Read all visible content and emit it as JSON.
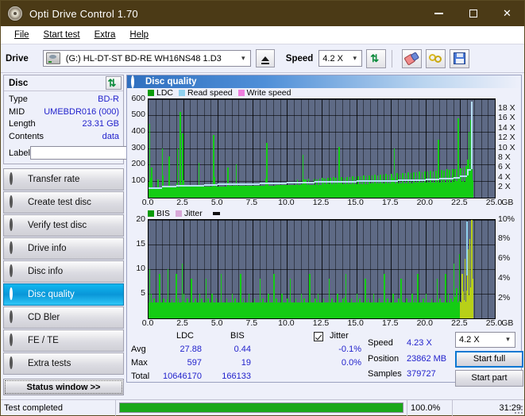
{
  "window": {
    "title": "Opti Drive Control 1.70",
    "icon": "disc-icon",
    "minimize": "–",
    "maximize": "□",
    "close": "✕"
  },
  "menubar": {
    "items": [
      "File",
      "Start test",
      "Extra",
      "Help"
    ]
  },
  "drivebar": {
    "drive_label": "Drive",
    "drive_value": "(G:)  HL-DT-ST BD-RE  WH16NS48 1.D3",
    "eject_icon": "eject-icon",
    "speed_label": "Speed",
    "speed_value": "4.2 X",
    "refresh_icon": "refresh-icon",
    "eraser_icon": "eraser-icon",
    "rings_icon": "rings-icon",
    "save_icon": "floppy-save-icon"
  },
  "disc": {
    "title": "Disc",
    "refresh_icon": "refresh-icon",
    "rows": [
      {
        "key": "Type",
        "value": "BD-R"
      },
      {
        "key": "MID",
        "value": "UMEBDR016 (000)"
      },
      {
        "key": "Length",
        "value": "23.31 GB"
      },
      {
        "key": "Contents",
        "value": "data"
      }
    ],
    "label_key": "Label",
    "label_value": "",
    "label_placeholder": "",
    "cd_icon": "cd-disc-icon"
  },
  "sidebar": {
    "items": [
      {
        "label": "Transfer rate",
        "active": false
      },
      {
        "label": "Create test disc",
        "active": false
      },
      {
        "label": "Verify test disc",
        "active": false
      },
      {
        "label": "Drive info",
        "active": false
      },
      {
        "label": "Disc info",
        "active": false
      },
      {
        "label": "Disc quality",
        "active": true
      },
      {
        "label": "CD Bler",
        "active": false
      },
      {
        "label": "FE / TE",
        "active": false
      },
      {
        "label": "Extra tests",
        "active": false
      }
    ],
    "status_window_button": "Status window >>"
  },
  "panel": {
    "title": "Disc quality",
    "icon": "disc-quality-icon"
  },
  "stats": {
    "col_ldc": "LDC",
    "col_bis": "BIS",
    "row_avg": "Avg",
    "row_max": "Max",
    "row_total": "Total",
    "ldc_avg": "27.88",
    "ldc_max": "597",
    "ldc_total": "10646170",
    "bis_avg": "0.44",
    "bis_max": "19",
    "bis_total": "166133",
    "jitter_label": "Jitter",
    "jitter_checked": true,
    "jitter_avg": "-0.1%",
    "jitter_max": "0.0%",
    "speed_label": "Speed",
    "speed_value": "4.23 X",
    "position_label": "Position",
    "position_value": "23862 MB",
    "samples_label": "Samples",
    "samples_value": "379727",
    "speed_select": "4.2 X",
    "start_full": "Start full",
    "start_part": "Start part"
  },
  "statusbar": {
    "message": "Test completed",
    "percent_label": "100.0%",
    "percent_value": 100,
    "elapsed": "31:29"
  },
  "colors": {
    "ldc_green": "#14cc14",
    "bis_green": "#14cc14",
    "read_speed": "#b7dff5",
    "write_speed": "#ee7ddd",
    "jitter": "#d8a8d8",
    "plot_bg": "#5e6a85",
    "accent_blue": "#2222cc",
    "title_bar": "#4b3a16"
  },
  "chart_data": [
    {
      "type": "area",
      "id": "ldc-chart",
      "title": "",
      "xlabel": "GB",
      "ylabel": "LDC",
      "y2label": "X",
      "xlim": [
        0,
        25.0
      ],
      "ylim": [
        0,
        600
      ],
      "y2lim": [
        0,
        18
      ],
      "grid": true,
      "legend_position": "top-left",
      "legend": [
        {
          "name": "LDC",
          "color": "#14aa14"
        },
        {
          "name": "Read speed",
          "color": "#8fd0ee"
        },
        {
          "name": "Write speed",
          "color": "#ee7ddd"
        }
      ],
      "xticks": [
        "0.0",
        "2.5",
        "5.0",
        "7.5",
        "10.0",
        "12.5",
        "15.0",
        "17.5",
        "20.0",
        "22.5",
        "25.0"
      ],
      "yticks": [
        100,
        200,
        300,
        400,
        500,
        600
      ],
      "y2ticks": [
        "2 X",
        "4 X",
        "6 X",
        "8 X",
        "10 X",
        "12 X",
        "14 X",
        "16 X",
        "18 X"
      ],
      "series": [
        {
          "name": "LDC",
          "color": "#14cc14",
          "x": [
            0.05,
            0.12,
            0.2,
            0.28,
            0.35,
            0.45,
            0.55,
            0.65,
            0.75,
            0.85,
            0.95,
            1.05,
            1.15,
            1.25,
            1.35,
            1.45,
            1.55,
            1.65,
            1.75,
            1.85,
            1.95,
            2.05,
            2.15,
            2.25,
            2.35,
            2.42,
            2.5,
            2.6,
            2.7,
            2.8,
            2.9,
            3.0,
            3.15,
            3.3,
            3.45,
            3.6,
            3.75,
            3.9,
            4.05,
            4.2,
            4.35,
            4.5,
            4.65,
            4.8,
            4.95,
            5.1,
            5.3,
            5.5,
            5.7,
            5.9,
            6.1,
            6.3,
            6.5,
            6.7,
            6.9,
            7.1,
            7.3,
            7.5,
            7.7,
            7.9,
            8.1,
            8.3,
            8.5,
            8.7,
            8.9,
            9.1,
            9.3,
            9.5,
            9.7,
            9.9,
            10.1,
            10.3,
            10.5,
            10.7,
            10.9,
            11.1,
            11.3,
            11.5,
            11.7,
            11.9,
            12.1,
            12.3,
            12.5,
            12.7,
            12.9,
            13.1,
            13.3,
            13.5,
            13.7,
            13.9,
            14.1,
            14.3,
            14.5,
            14.7,
            14.9,
            15.1,
            15.3,
            15.5,
            15.7,
            15.9,
            16.1,
            16.3,
            16.5,
            16.7,
            16.9,
            17.1,
            17.3,
            17.5,
            17.7,
            17.9,
            18.1,
            18.3,
            18.5,
            18.7,
            18.9,
            19.1,
            19.3,
            19.5,
            19.7,
            19.9,
            20.1,
            20.3,
            20.5,
            20.7,
            20.9,
            21.1,
            21.3,
            21.5,
            21.7,
            21.9,
            22.1,
            22.3,
            22.5,
            22.7,
            22.9,
            23.0,
            23.1,
            23.2,
            23.3
          ],
          "y": [
            450,
            120,
            180,
            95,
            75,
            70,
            68,
            110,
            70,
            65,
            300,
            72,
            68,
            70,
            66,
            250,
            70,
            68,
            72,
            66,
            70,
            300,
            80,
            520,
            75,
            390,
            72,
            70,
            75,
            80,
            70,
            78,
            80,
            72,
            78,
            210,
            80,
            78,
            75,
            85,
            80,
            78,
            380,
            82,
            85,
            80,
            88,
            85,
            180,
            90,
            88,
            200,
            92,
            88,
            90,
            95,
            92,
            90,
            95,
            100,
            98,
            95,
            330,
            100,
            98,
            102,
            100,
            105,
            102,
            108,
            105,
            100,
            108,
            110,
            105,
            260,
            110,
            112,
            108,
            115,
            110,
            112,
            118,
            115,
            120,
            118,
            122,
            120,
            310,
            125,
            120,
            122,
            125,
            128,
            125,
            130,
            128,
            132,
            130,
            135,
            132,
            138,
            135,
            140,
            138,
            142,
            140,
            145,
            300,
            148,
            145,
            150,
            148,
            152,
            150,
            155,
            152,
            158,
            155,
            160,
            158,
            162,
            160,
            165,
            350,
            168,
            165,
            170,
            168,
            172,
            170,
            480,
            175,
            180,
            190,
            230,
            400,
            470,
            480,
            260
          ]
        },
        {
          "name": "Read speed",
          "color": "#b7dff5",
          "x": [
            0.0,
            1.0,
            2.0,
            3.0,
            4.0,
            5.0,
            6.0,
            7.0,
            8.0,
            9.0,
            10.0,
            11.0,
            12.0,
            13.0,
            14.0,
            15.0,
            16.0,
            17.0,
            18.0,
            19.0,
            20.0,
            21.0,
            22.0,
            22.5,
            23.0,
            23.3
          ],
          "y": [
            1.9,
            2.1,
            2.2,
            2.3,
            2.4,
            2.5,
            2.55,
            2.6,
            2.7,
            2.75,
            2.8,
            2.9,
            2.95,
            3.0,
            3.05,
            3.1,
            3.15,
            3.2,
            3.3,
            3.35,
            3.4,
            3.5,
            3.7,
            4.0,
            5.2,
            17.5
          ]
        }
      ]
    },
    {
      "type": "area",
      "id": "bis-chart",
      "title": "",
      "xlabel": "GB",
      "ylabel": "BIS",
      "y2label": "%",
      "xlim": [
        0,
        25.0
      ],
      "ylim": [
        0,
        20
      ],
      "y2lim": [
        0,
        10
      ],
      "grid": true,
      "legend_position": "top-left",
      "legend": [
        {
          "name": "BIS",
          "color": "#14aa14"
        },
        {
          "name": "Jitter",
          "color": "#d8a8d8"
        }
      ],
      "xticks": [
        "0.0",
        "2.5",
        "5.0",
        "7.5",
        "10.0",
        "12.5",
        "15.0",
        "17.5",
        "20.0",
        "22.5",
        "25.0"
      ],
      "yticks": [
        5,
        10,
        15,
        20
      ],
      "y2ticks": [
        "2%",
        "4%",
        "6%",
        "8%",
        "10%"
      ],
      "series": [
        {
          "name": "BIS",
          "color": "#14cc14",
          "x": [
            0.05,
            0.15,
            0.25,
            0.35,
            0.45,
            0.6,
            0.75,
            0.9,
            1.05,
            1.2,
            1.35,
            1.5,
            1.65,
            1.8,
            1.95,
            2.1,
            2.25,
            2.4,
            2.5,
            2.6,
            2.75,
            2.9,
            3.05,
            3.2,
            3.35,
            3.5,
            3.65,
            3.8,
            3.95,
            4.1,
            4.25,
            4.4,
            4.55,
            4.7,
            4.85,
            5.0,
            5.2,
            5.4,
            5.6,
            5.8,
            6.0,
            6.2,
            6.4,
            6.6,
            6.8,
            7.0,
            7.2,
            7.4,
            7.6,
            7.8,
            8.0,
            8.2,
            8.4,
            8.6,
            8.8,
            9.0,
            9.2,
            9.4,
            9.6,
            9.8,
            10.0,
            10.2,
            10.4,
            10.6,
            10.8,
            11.0,
            11.2,
            11.4,
            11.6,
            11.8,
            12.0,
            12.2,
            12.4,
            12.6,
            12.8,
            13.0,
            13.2,
            13.4,
            13.6,
            13.8,
            14.0,
            14.2,
            14.4,
            14.6,
            14.8,
            15.0,
            15.2,
            15.4,
            15.6,
            15.8,
            16.0,
            16.2,
            16.4,
            16.6,
            16.8,
            17.0,
            17.2,
            17.4,
            17.6,
            17.8,
            18.0,
            18.2,
            18.4,
            18.6,
            18.8,
            19.0,
            19.2,
            19.4,
            19.6,
            19.8,
            20.0,
            20.2,
            20.4,
            20.6,
            20.8,
            21.0,
            21.2,
            21.4,
            21.6,
            21.8,
            22.0,
            22.2,
            22.4,
            22.6,
            22.8,
            23.0,
            23.15,
            23.3
          ],
          "y": [
            10,
            5,
            3,
            4,
            3,
            3,
            9,
            3,
            4,
            3,
            10,
            3,
            4,
            3,
            9,
            4,
            3,
            11,
            5,
            3,
            4,
            3,
            8,
            3,
            4,
            3,
            5,
            4,
            3,
            8,
            4,
            3,
            5,
            3,
            4,
            3,
            9,
            3,
            4,
            3,
            5,
            4,
            3,
            9,
            4,
            3,
            5,
            3,
            4,
            3,
            8,
            4,
            3,
            5,
            3,
            9,
            4,
            3,
            5,
            3,
            4,
            8,
            3,
            4,
            3,
            5,
            4,
            3,
            9,
            3,
            4,
            5,
            3,
            4,
            3,
            8,
            4,
            3,
            5,
            3,
            4,
            9,
            3,
            4,
            3,
            5,
            4,
            3,
            8,
            4,
            3,
            5,
            3,
            4,
            3,
            9,
            4,
            3,
            5,
            3,
            4,
            8,
            3,
            4,
            3,
            5,
            4,
            9,
            3,
            4,
            5,
            3,
            4,
            3,
            8,
            4,
            3,
            9,
            5,
            4,
            11,
            6,
            13,
            9,
            12,
            14,
            16,
            20
          ]
        }
      ]
    }
  ]
}
